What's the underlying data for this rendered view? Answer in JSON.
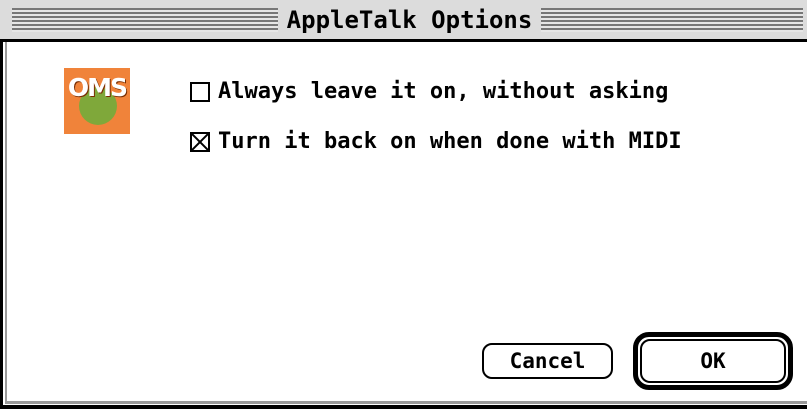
{
  "window": {
    "title": "AppleTalk Options"
  },
  "icon": {
    "name": "oms-icon",
    "text": "OMS",
    "colors": {
      "background": "#f0833a",
      "disc": "#7fa83a",
      "text": "#ffffff"
    }
  },
  "options": [
    {
      "label": "Always leave it on, without asking",
      "checked": false
    },
    {
      "label": "Turn it back on when done with MIDI",
      "checked": true
    }
  ],
  "buttons": {
    "cancel_label": "Cancel",
    "ok_label": "OK",
    "default": "OK"
  }
}
